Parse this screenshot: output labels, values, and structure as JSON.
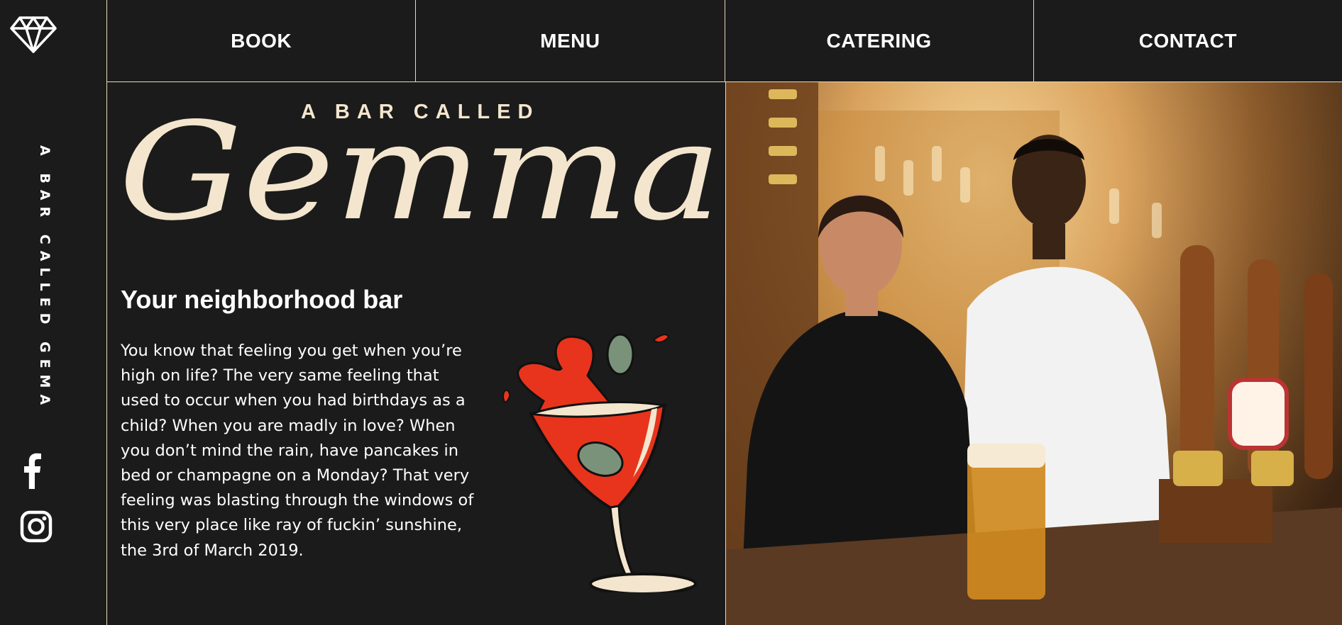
{
  "brand": {
    "logo_icon": "diamond-icon",
    "vertical_name": "A BAR CALLED GEMA"
  },
  "social": {
    "facebook_icon": "facebook-icon",
    "instagram_icon": "instagram-icon"
  },
  "nav": {
    "items": [
      {
        "label": "BOOK"
      },
      {
        "label": "MENU"
      },
      {
        "label": "CATERING"
      },
      {
        "label": "CONTACT"
      }
    ]
  },
  "hero": {
    "pre_title": "A BAR CALLED",
    "script_title": "Gemma",
    "heading": "Your neighborhood bar",
    "body": "You know that feeling you get when you’re high on life? The very same feeling that used to occur when you had birthdays as a child? When you are madly in love? When you don’t mind the rain, have pancakes in bed or champagne on a Monday? That very feeling was blasting through the windows of this very place like ray of fuckin’ sunshine, the 3rd of March 2019."
  },
  "illustration": "cocktail-martini-illustration",
  "photo": "bartenders-photo",
  "colors": {
    "background": "#1b1b1b",
    "accent_cream": "#f4e6ce",
    "border": "#e9d9b8",
    "drink_red": "#e8341c",
    "olive": "#7a927a"
  }
}
